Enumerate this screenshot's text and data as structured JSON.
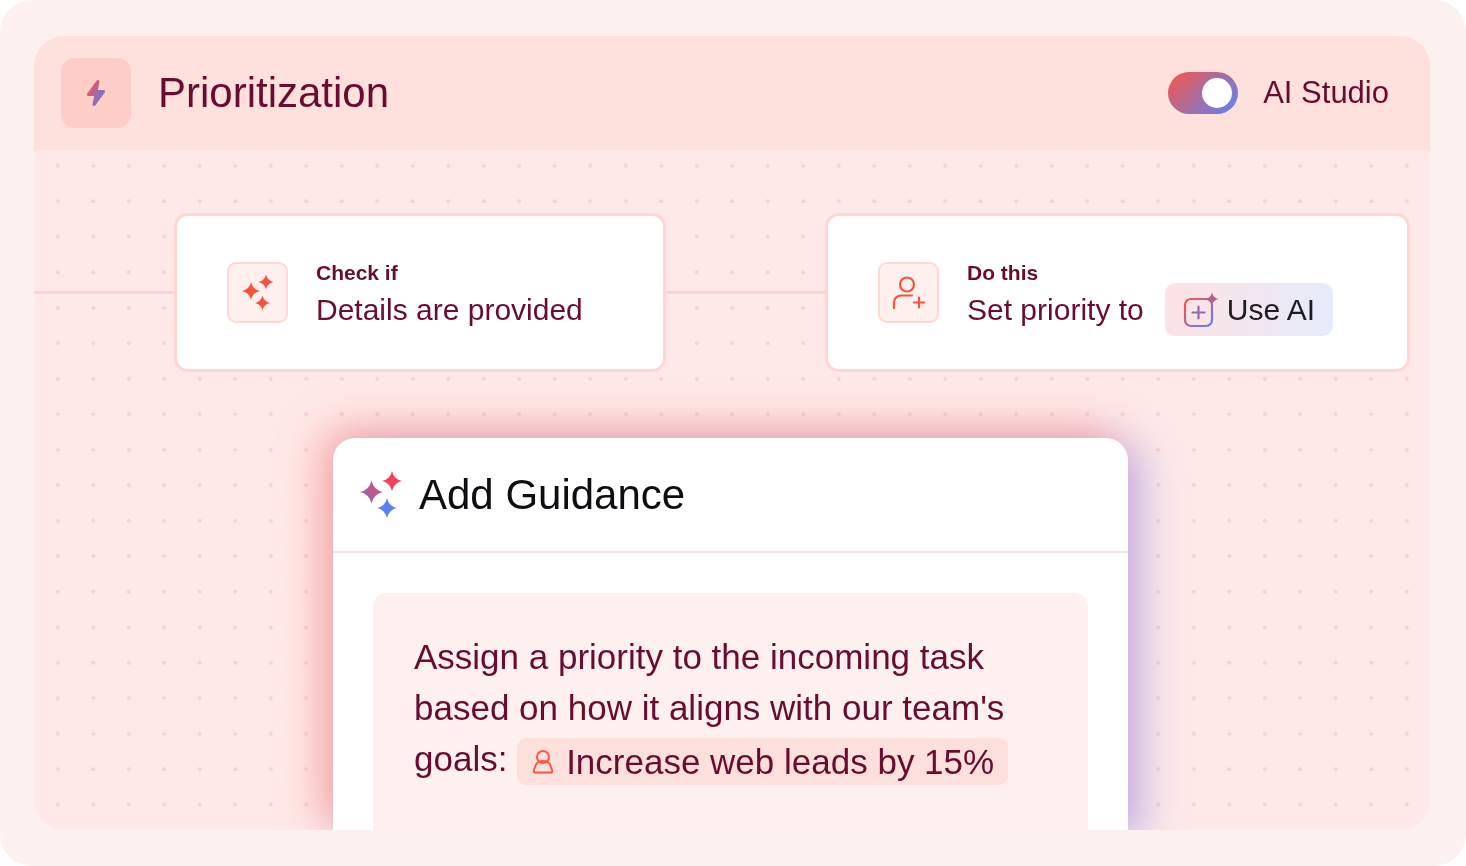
{
  "header": {
    "title": "Prioritization",
    "toggle": {
      "label": "AI Studio",
      "on": true
    }
  },
  "steps": [
    {
      "kind": "condition",
      "heading": "Check if",
      "text": "Details are provided"
    },
    {
      "kind": "action",
      "heading": "Do this",
      "text": "Set priority to",
      "button": {
        "label": "Use AI"
      }
    }
  ],
  "guidance": {
    "title": "Add Guidance",
    "text": "Assign a priority to the incoming task based on how it aligns with our team's goals:",
    "goal": {
      "label": "Increase web leads by 15%"
    }
  }
}
